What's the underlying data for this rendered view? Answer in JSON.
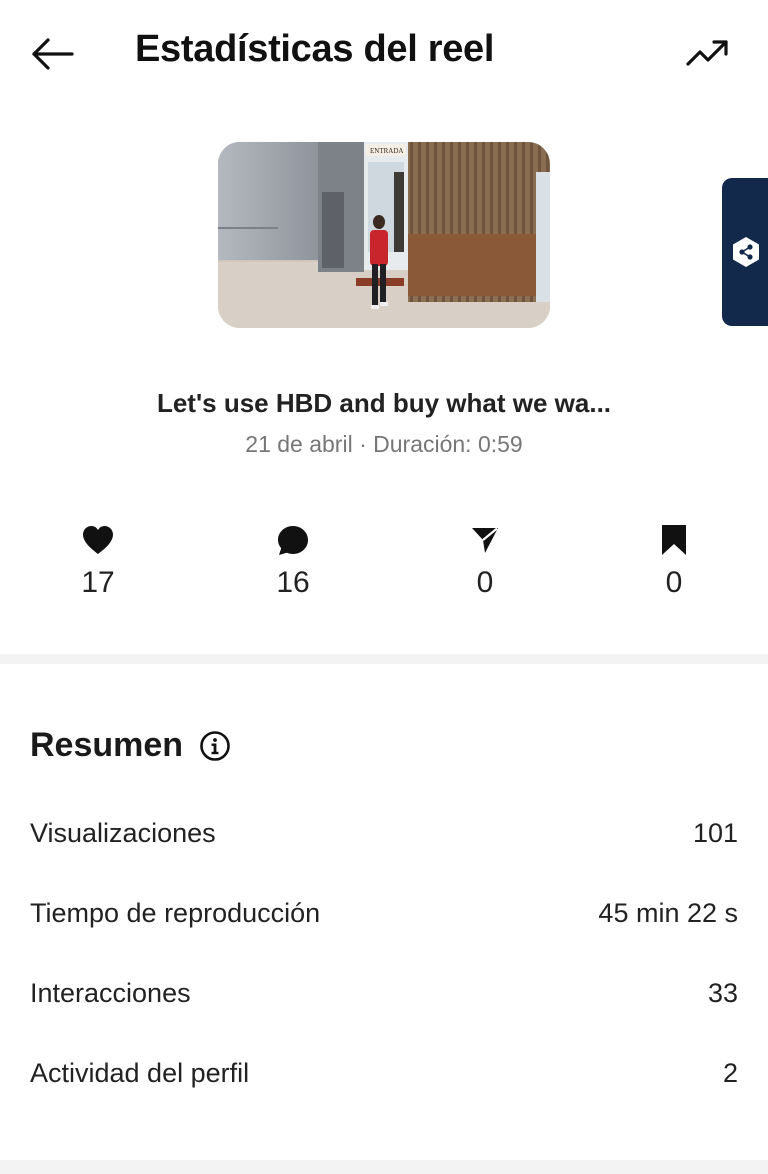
{
  "header": {
    "title": "Estadísticas del reel"
  },
  "reel": {
    "title": "Let's use HBD and buy what we wa...",
    "meta": "21 de abril · Duración: 0:59",
    "sign_text": "ENTRADA"
  },
  "stats": [
    {
      "icon": "heart-icon",
      "value": "17"
    },
    {
      "icon": "comment-icon",
      "value": "16"
    },
    {
      "icon": "share-icon",
      "value": "0"
    },
    {
      "icon": "bookmark-icon",
      "value": "0"
    }
  ],
  "summary": {
    "heading": "Resumen",
    "rows": [
      {
        "label": "Visualizaciones",
        "value": "101"
      },
      {
        "label": "Tiempo de reproducción",
        "value": "45 min 22 s"
      },
      {
        "label": "Interacciones",
        "value": "33"
      },
      {
        "label": "Actividad del perfil",
        "value": "2"
      }
    ]
  },
  "colors": {
    "side_tab": "#13294b",
    "accent_red": "#c8262c"
  }
}
